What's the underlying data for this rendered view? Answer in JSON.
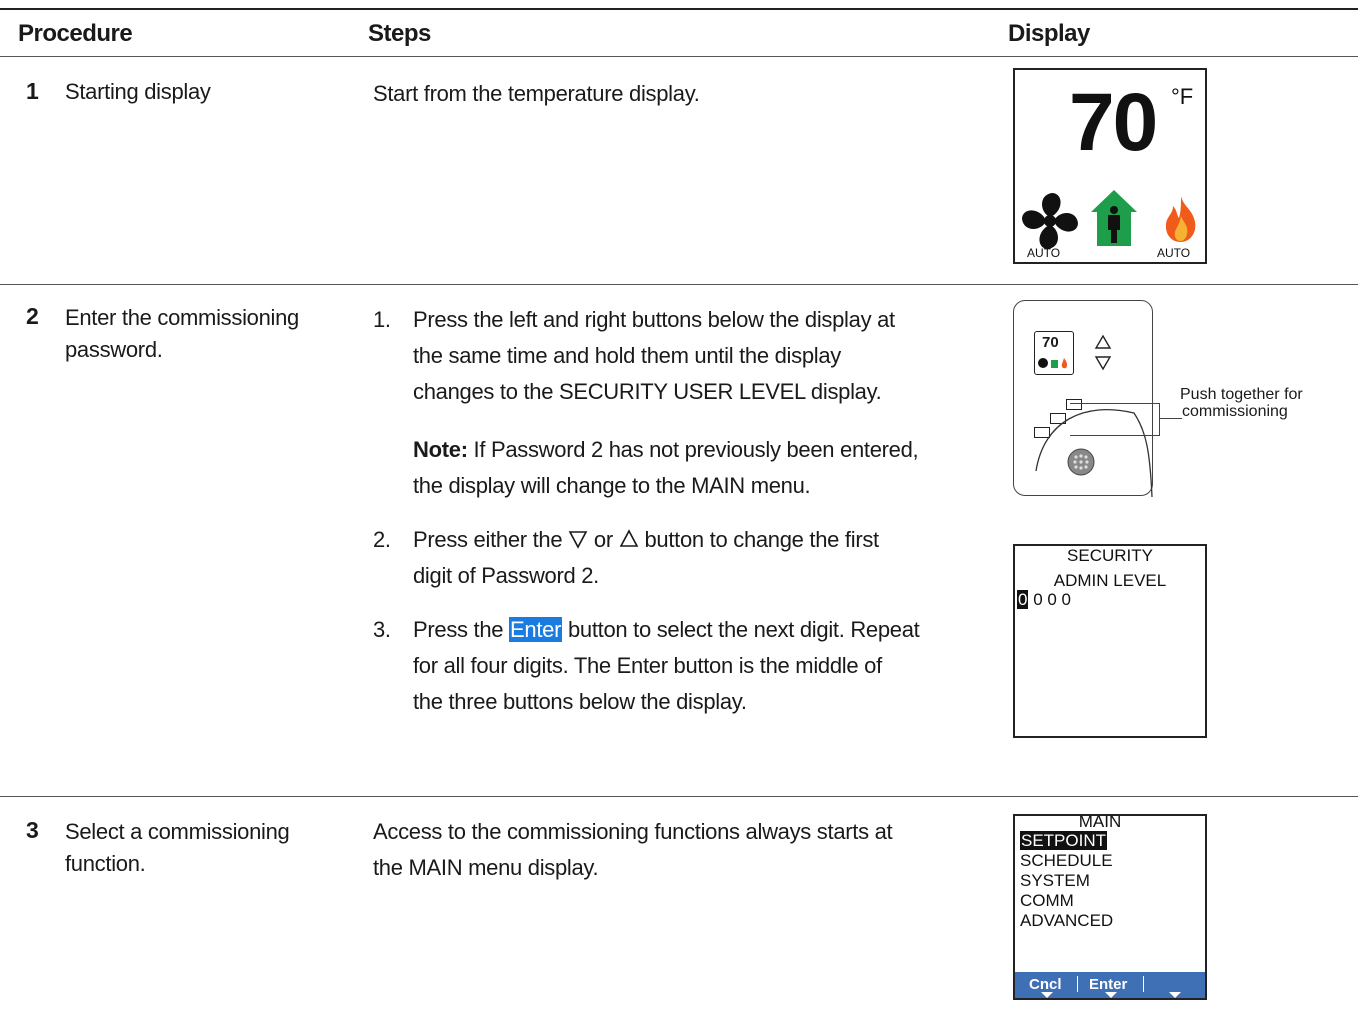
{
  "headers": {
    "procedure": "Procedure",
    "steps": "Steps",
    "display": "Display"
  },
  "rows": [
    {
      "number": "1",
      "procedure": "Starting display",
      "steps": "Start from the temperature display.",
      "display": {
        "temperature": "70",
        "unit": "°F",
        "left_mode": "AUTO",
        "right_mode": "AUTO"
      }
    },
    {
      "number": "2",
      "procedure_line1": "Enter the commissioning",
      "procedure_line2": "password.",
      "step1_num": "1.",
      "step1_line1": "Press the left and right buttons below the display at",
      "step1_line2": "the same time and hold them until the display",
      "step1_line3": "changes to the SECURITY USER LEVEL display.",
      "note_label": "Note:",
      "note_line1": " If Password 2 has not previously been entered,",
      "note_line2": "the display will change to the MAIN menu.",
      "step2_num": "2.",
      "step2_pre": "Press either the ",
      "step2_mid": " or ",
      "step2_post": " button to change the first",
      "step2_line2": "digit of Password 2.",
      "step3_num": "3.",
      "step3_pre": "Press the ",
      "step3_enter": "Enter",
      "step3_post": " button to select the next digit. Repeat",
      "step3_line2": "for all four digits. The Enter button is the middle of",
      "step3_line3": "the three buttons below the display.",
      "thermostat": {
        "temperature": "70",
        "callout_line1": "Push together for",
        "callout_line2": "commissioning"
      },
      "security_display": {
        "line1": "SECURITY",
        "line2": "ADMIN LEVEL",
        "digit_selected": "0",
        "digits_rest": "0 0 0"
      }
    },
    {
      "number": "3",
      "procedure_line1": "Select a commissioning",
      "procedure_line2": "function.",
      "steps_line1": "Access to the commissioning functions always starts at",
      "steps_line2": "the MAIN menu display.",
      "main_menu": {
        "title": "MAIN",
        "items": [
          "SETPOINT",
          "SCHEDULE",
          "SYSTEM",
          "COMM",
          "ADVANCED"
        ],
        "softkeys": [
          "Cncl",
          "Enter"
        ]
      }
    }
  ],
  "colors": {
    "enter_highlight": "#1a7be0",
    "softkey_bar": "#3f6fb5",
    "house_green": "#1e9e4a",
    "flame_orange": "#f05a1a"
  }
}
